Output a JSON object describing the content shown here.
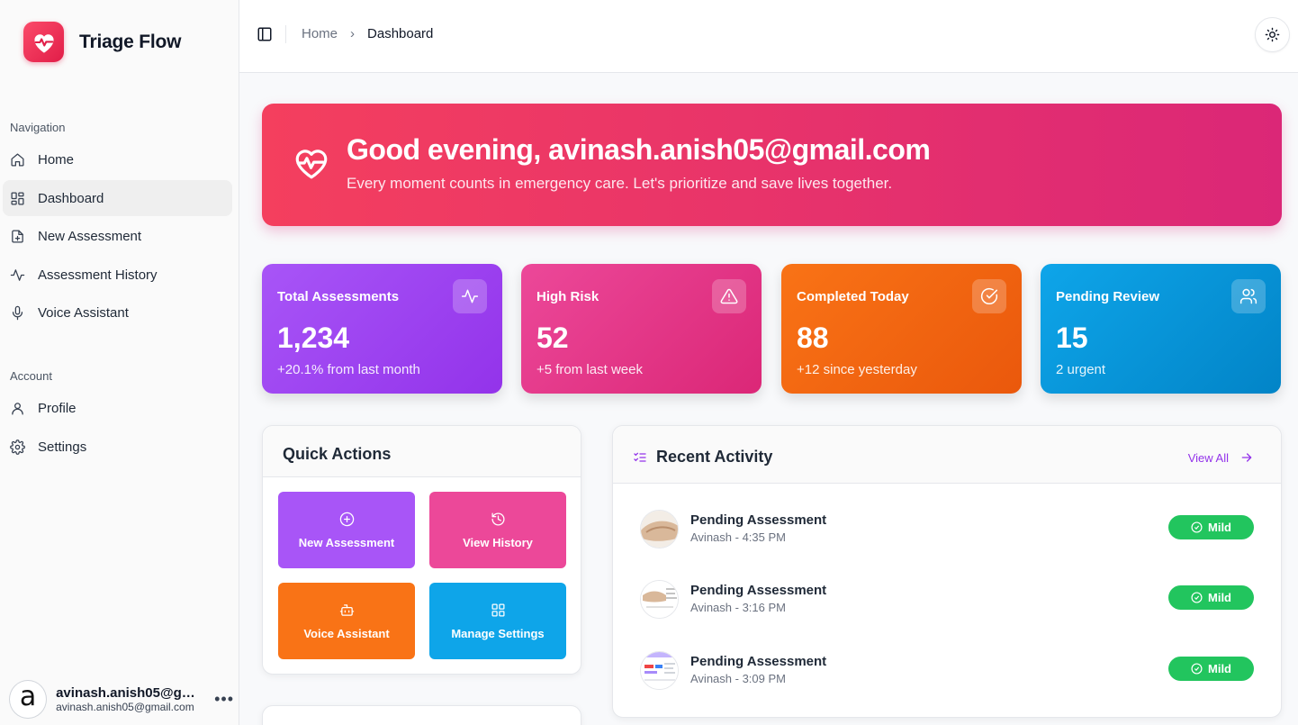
{
  "app": {
    "name": "Triage Flow"
  },
  "sidebar": {
    "navigation_label": "Navigation",
    "nav_items": [
      {
        "label": "Home",
        "icon": "home-icon"
      },
      {
        "label": "Dashboard",
        "icon": "dashboard-icon",
        "active": true
      },
      {
        "label": "New Assessment",
        "icon": "file-plus-icon"
      },
      {
        "label": "Assessment History",
        "icon": "activity-icon"
      },
      {
        "label": "Voice Assistant",
        "icon": "mic-icon"
      }
    ],
    "account_label": "Account",
    "account_items": [
      {
        "label": "Profile",
        "icon": "user-icon"
      },
      {
        "label": "Settings",
        "icon": "gear-icon"
      }
    ],
    "user": {
      "avatar_letter": "a",
      "name": "avinash.anish05@gmail.com",
      "email": "avinash.anish05@gmail.com"
    }
  },
  "header": {
    "breadcrumb": [
      "Home",
      "Dashboard"
    ]
  },
  "hero": {
    "title": "Good evening, avinash.anish05@gmail.com",
    "subtitle": "Every moment counts in emergency care. Let's prioritize and save lives together."
  },
  "stats": [
    {
      "label": "Total Assessments",
      "value": "1,234",
      "sub": "+20.1% from last month",
      "icon": "activity-icon",
      "color": "#9333ea"
    },
    {
      "label": "High Risk",
      "value": "52",
      "sub": "+5 from last week",
      "icon": "alert-triangle-icon",
      "color": "#db2777"
    },
    {
      "label": "Completed Today",
      "value": "88",
      "sub": "+12 since yesterday",
      "icon": "check-circle-icon",
      "color": "#ea580c"
    },
    {
      "label": "Pending Review",
      "value": "15",
      "sub": "2 urgent",
      "icon": "users-icon",
      "color": "#0284c7"
    }
  ],
  "quick_actions": {
    "title": "Quick Actions",
    "buttons": [
      {
        "label": "New Assessment",
        "icon": "plus-circle-icon",
        "color": "#a855f7"
      },
      {
        "label": "View History",
        "icon": "history-icon",
        "color": "#ec4899"
      },
      {
        "label": "Voice Assistant",
        "icon": "bot-icon",
        "color": "#f97316"
      },
      {
        "label": "Manage Settings",
        "icon": "grid-icon",
        "color": "#0ea5e9"
      }
    ]
  },
  "recent_activity": {
    "title": "Recent Activity",
    "view_all": "View All",
    "items": [
      {
        "title": "Pending Assessment",
        "meta": "Avinash - 4:35 PM",
        "badge": "Mild"
      },
      {
        "title": "Pending Assessment",
        "meta": "Avinash - 3:16 PM",
        "badge": "Mild"
      },
      {
        "title": "Pending Assessment",
        "meta": "Avinash - 3:09 PM",
        "badge": "Mild"
      }
    ]
  }
}
